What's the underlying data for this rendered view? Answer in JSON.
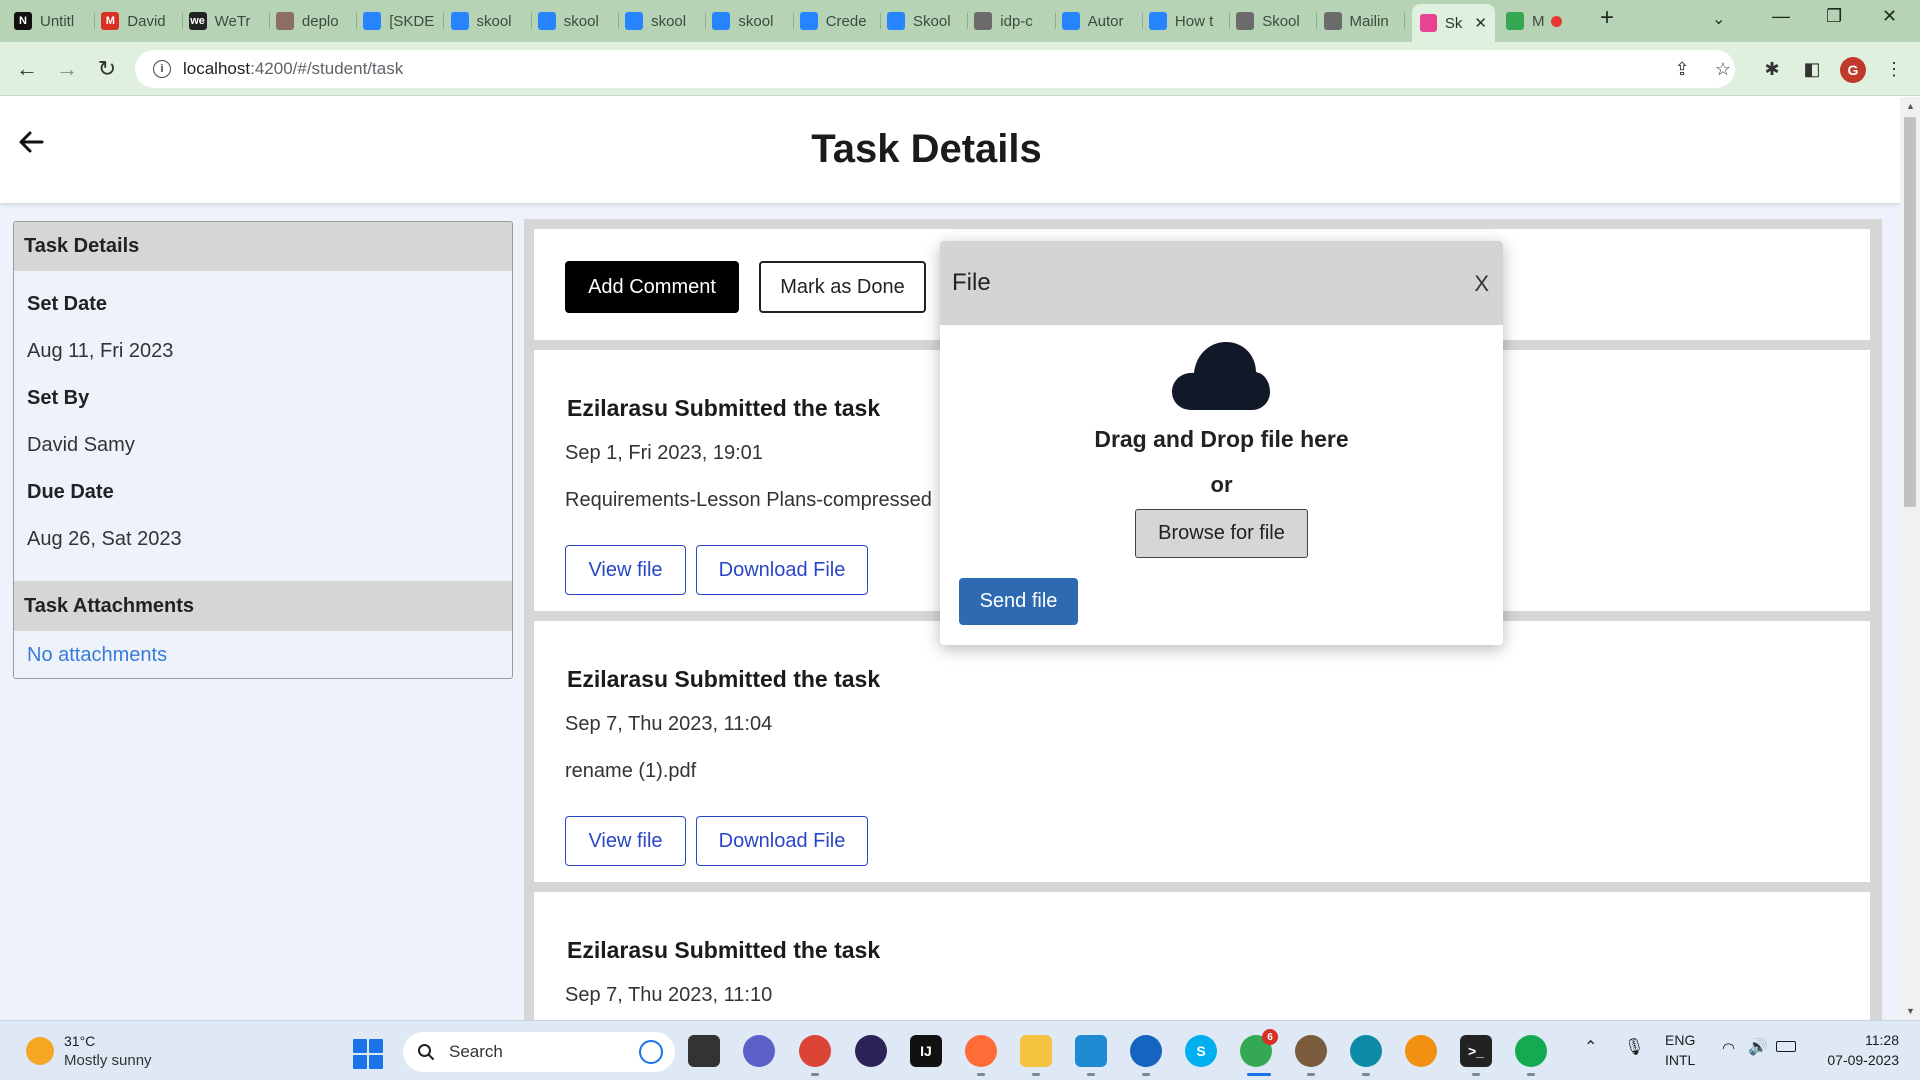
{
  "browser": {
    "tabs": [
      {
        "label": "Untitl",
        "icon": "notion-icon",
        "color": "#111111",
        "glyph": "N"
      },
      {
        "label": "David",
        "icon": "gmail-icon",
        "color": "#d93025",
        "glyph": "M"
      },
      {
        "label": "WeTr",
        "icon": "wetransfer-icon",
        "color": "#222222",
        "glyph": "we"
      },
      {
        "label": "deplo",
        "icon": "avatar-icon",
        "color": "#8d6e63",
        "glyph": ""
      },
      {
        "label": "[SKDE",
        "icon": "jira-icon",
        "color": "#2684ff",
        "glyph": ""
      },
      {
        "label": "skool",
        "icon": "doc-icon",
        "color": "#2684ff",
        "glyph": ""
      },
      {
        "label": "skool",
        "icon": "doc-icon",
        "color": "#2684ff",
        "glyph": ""
      },
      {
        "label": "skool",
        "icon": "doc-icon",
        "color": "#2684ff",
        "glyph": ""
      },
      {
        "label": "skool",
        "icon": "doc-icon",
        "color": "#2684ff",
        "glyph": ""
      },
      {
        "label": "Crede",
        "icon": "confluence-icon",
        "color": "#2684ff",
        "glyph": ""
      },
      {
        "label": "Skool",
        "icon": "confluence-icon",
        "color": "#2684ff",
        "glyph": ""
      },
      {
        "label": "idp-c",
        "icon": "globe-icon",
        "color": "#6b6b6b",
        "glyph": ""
      },
      {
        "label": "Autor",
        "icon": "confluence-icon",
        "color": "#2684ff",
        "glyph": ""
      },
      {
        "label": "How t",
        "icon": "confluence-icon",
        "color": "#2684ff",
        "glyph": ""
      },
      {
        "label": "Skool",
        "icon": "globe-icon",
        "color": "#6b6b6b",
        "glyph": ""
      },
      {
        "label": "Mailin",
        "icon": "globe-icon",
        "color": "#6b6b6b",
        "glyph": ""
      }
    ],
    "active_tab": {
      "label": "Sk",
      "icon": "skool-app-icon",
      "color": "#e84393"
    },
    "last_tab": {
      "label": "M",
      "icon": "meet-icon",
      "color": "#34a853"
    },
    "url_host": "localhost",
    "url_path": ":4200/#/student/task",
    "profile_initial": "G"
  },
  "page": {
    "title": "Task Details"
  },
  "left_panel": {
    "header": "Task Details",
    "set_date_label": "Set Date",
    "set_date_value": "Aug 11, Fri 2023",
    "set_by_label": "Set By",
    "set_by_value": "David Samy",
    "due_date_label": "Due Date",
    "due_date_value": "Aug 26, Sat 2023",
    "attachments_header": "Task Attachments",
    "attachments_value": "No attachments"
  },
  "actions": {
    "add_comment": "Add Comment",
    "mark_done": "Mark as Done"
  },
  "submissions": [
    {
      "title": "Ezilarasu Submitted the task",
      "date": "Sep 1, Fri 2023, 19:01",
      "file": "Requirements-Lesson Plans-compressed",
      "view": "View file",
      "download": "Download File"
    },
    {
      "title": "Ezilarasu Submitted the task",
      "date": "Sep 7, Thu 2023, 11:04",
      "file": "rename (1).pdf",
      "view": "View file",
      "download": "Download File"
    },
    {
      "title": "Ezilarasu Submitted the task",
      "date": "Sep 7, Thu 2023, 11:10",
      "file": "",
      "view": "",
      "download": ""
    }
  ],
  "modal": {
    "title": "File",
    "close": "X",
    "drop_text": "Drag and Drop file here",
    "or_text": "or",
    "browse": "Browse for file",
    "send": "Send file"
  },
  "taskbar": {
    "temp": "31°C",
    "weather": "Mostly sunny",
    "search": "Search",
    "lang_top": "ENG",
    "lang_bottom": "INTL",
    "time": "11:28",
    "date": "07-09-2023",
    "chrome_badge": "6"
  },
  "colors": {
    "accent_blue": "#2d6ab2",
    "link_blue": "#3a7bd5",
    "outline_blue": "#2946c8",
    "panel_bg": "#eef3fb"
  }
}
